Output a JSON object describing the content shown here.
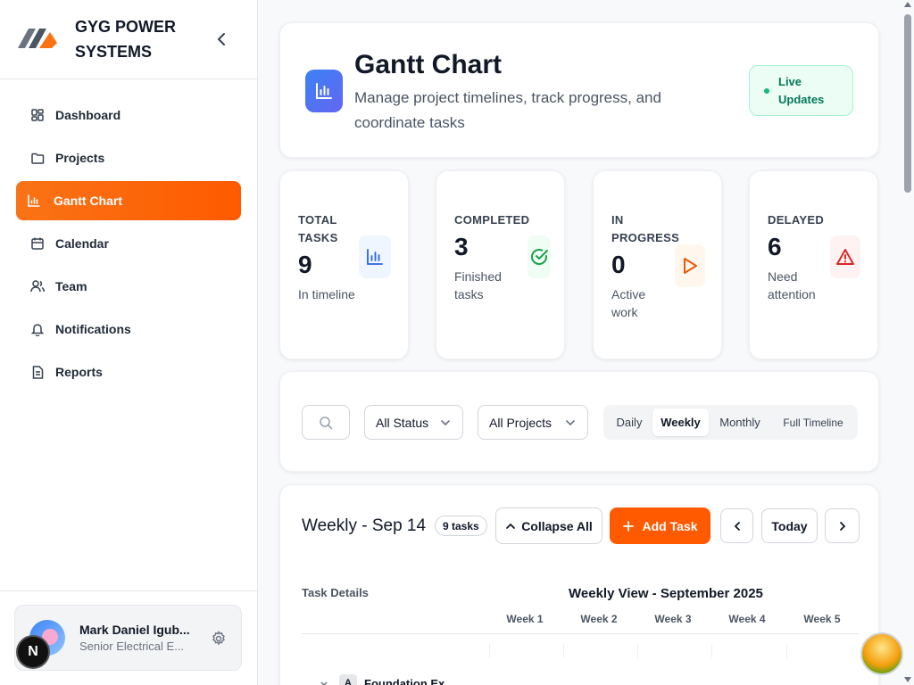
{
  "brand": {
    "name": "GYG POWER SYSTEMS"
  },
  "sidebar": {
    "items": [
      {
        "label": "Dashboard",
        "icon": "grid-icon"
      },
      {
        "label": "Projects",
        "icon": "folder-icon"
      },
      {
        "label": "Gantt Chart",
        "icon": "bar-chart-icon",
        "active": true
      },
      {
        "label": "Calendar",
        "icon": "calendar-icon"
      },
      {
        "label": "Team",
        "icon": "users-icon"
      },
      {
        "label": "Notifications",
        "icon": "bell-icon"
      },
      {
        "label": "Reports",
        "icon": "document-icon"
      }
    ]
  },
  "user": {
    "name": "Mark Daniel Igub...",
    "role": "Senior Electrical E...",
    "badge": "N"
  },
  "header": {
    "title": "Gantt Chart",
    "subtitle": "Manage project timelines, track progress, and coordinate tasks",
    "live_badge": "Live Updates"
  },
  "stats": [
    {
      "label": "TOTAL TASKS",
      "value": "9",
      "sub": "In timeline",
      "icon": "bar-chart-icon",
      "color": "#2563eb",
      "bg": "#eff6ff"
    },
    {
      "label": "COMPLETED",
      "value": "3",
      "sub": "Finished tasks",
      "icon": "check-circle-icon",
      "color": "#16a34a",
      "bg": "#f0fdf4"
    },
    {
      "label": "IN PROGRESS",
      "value": "0",
      "sub": "Active work",
      "icon": "play-icon",
      "color": "#ea580c",
      "bg": "#fff7ed"
    },
    {
      "label": "DELAYED",
      "value": "6",
      "sub": "Need attention",
      "icon": "alert-triangle-icon",
      "color": "#dc2626",
      "bg": "#fef2f2"
    }
  ],
  "filters": {
    "status_select": "All Status",
    "project_select": "All Projects",
    "views": [
      "Daily",
      "Weekly",
      "Monthly",
      "Full Timeline"
    ],
    "active_view": "Weekly"
  },
  "gantt": {
    "title": "Weekly - Sep 14",
    "tasks_badge": "9 tasks",
    "collapse_label": "Collapse All",
    "add_task_label": "Add Task",
    "today_label": "Today",
    "task_details_label": "Task Details",
    "week_view_label": "Weekly View - September 2025",
    "weeks": [
      "Week 1",
      "Week 2",
      "Week 3",
      "Week 4",
      "Week 5"
    ],
    "first_row": {
      "letter": "A",
      "name": "Foundation Ex..."
    }
  },
  "colors": {
    "accent": "#ff5a00",
    "brand_blue": "#3b82f6"
  }
}
